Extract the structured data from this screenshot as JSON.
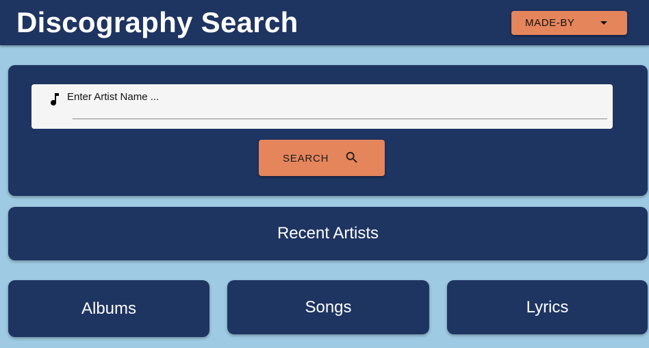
{
  "header": {
    "title": "Discography Search",
    "made_by_label": "MADE-BY"
  },
  "search": {
    "placeholder": "Enter Artist Name ...",
    "value": "",
    "button_label": "SEARCH"
  },
  "sections": {
    "recent_artists": "Recent Artists",
    "albums": "Albums",
    "songs": "Songs",
    "lyrics": "Lyrics"
  },
  "icons": {
    "input": "music-note-icon",
    "search_button": "search-icon",
    "dropdown": "caret-down-icon"
  },
  "colors": {
    "background": "#9ecae3",
    "primary": "#1e3461",
    "accent": "#e5855c",
    "input_background": "#f5f5f5",
    "text_light": "#ffffff",
    "text_dark": "#111111"
  }
}
